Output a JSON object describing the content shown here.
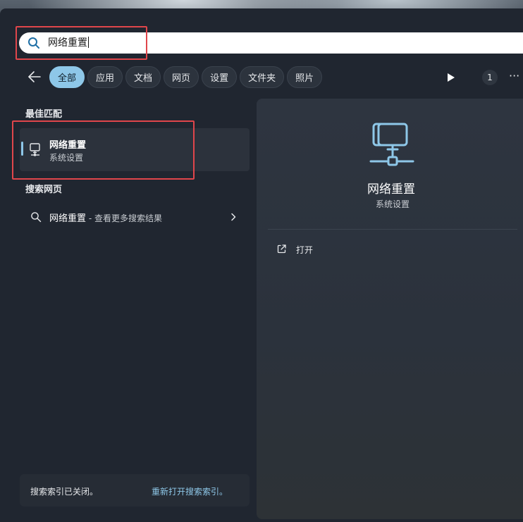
{
  "search": {
    "query": "网络重置"
  },
  "tabs": [
    {
      "label": "全部",
      "active": true
    },
    {
      "label": "应用"
    },
    {
      "label": "文档"
    },
    {
      "label": "网页"
    },
    {
      "label": "设置"
    },
    {
      "label": "文件夹"
    },
    {
      "label": "照片"
    }
  ],
  "toolbar": {
    "count": "1",
    "more": "···"
  },
  "best_match": {
    "heading": "最佳匹配",
    "title": "网络重置",
    "subtitle": "系统设置",
    "icon": "network-computer-icon"
  },
  "web": {
    "heading": "搜索网页",
    "query": "网络重置",
    "separator": " - ",
    "suffix": "查看更多搜索结果"
  },
  "footer": {
    "text": "搜索索引已关闭。",
    "link": "重新打开搜索索引。"
  },
  "details": {
    "title": "网络重置",
    "subtitle": "系统设置",
    "actions": [
      {
        "label": "打开",
        "icon": "open-external-icon"
      }
    ]
  },
  "colors": {
    "accent": "#8ec7e8",
    "highlight_box": "#e0464b",
    "panel": "#202630"
  }
}
